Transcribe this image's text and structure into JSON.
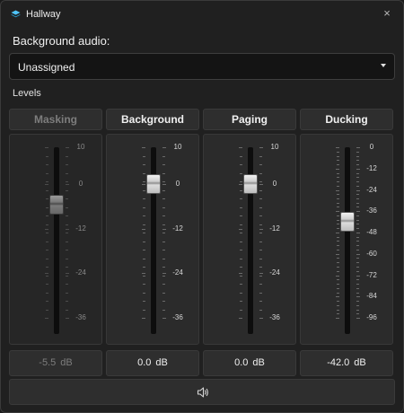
{
  "window": {
    "title": "Hallway",
    "close_glyph": "×",
    "icon": "layers-icon"
  },
  "background_audio": {
    "label": "Background audio:",
    "selected": "Unassigned"
  },
  "levels": {
    "label": "Levels",
    "channels": [
      {
        "name": "Masking",
        "value": "-5.5",
        "unit": "dB",
        "level_db": -5.5,
        "enabled": false,
        "scale": [
          "10",
          "0",
          "-12",
          "-24",
          "-36"
        ]
      },
      {
        "name": "Background",
        "value": "0.0",
        "unit": "dB",
        "level_db": 0.0,
        "enabled": true,
        "scale": [
          "10",
          "0",
          "-12",
          "-24",
          "-36"
        ]
      },
      {
        "name": "Paging",
        "value": "0.0",
        "unit": "dB",
        "level_db": 0.0,
        "enabled": true,
        "scale": [
          "10",
          "0",
          "-12",
          "-24",
          "-36"
        ]
      },
      {
        "name": "Ducking",
        "value": "-42.0",
        "unit": "dB",
        "level_db": -42.0,
        "enabled": true,
        "scale": [
          "0",
          "-12",
          "-24",
          "-36",
          "-48",
          "-60",
          "-72",
          "-84",
          "-96"
        ]
      }
    ]
  },
  "speaker_button": {
    "icon": "speaker-icon"
  }
}
